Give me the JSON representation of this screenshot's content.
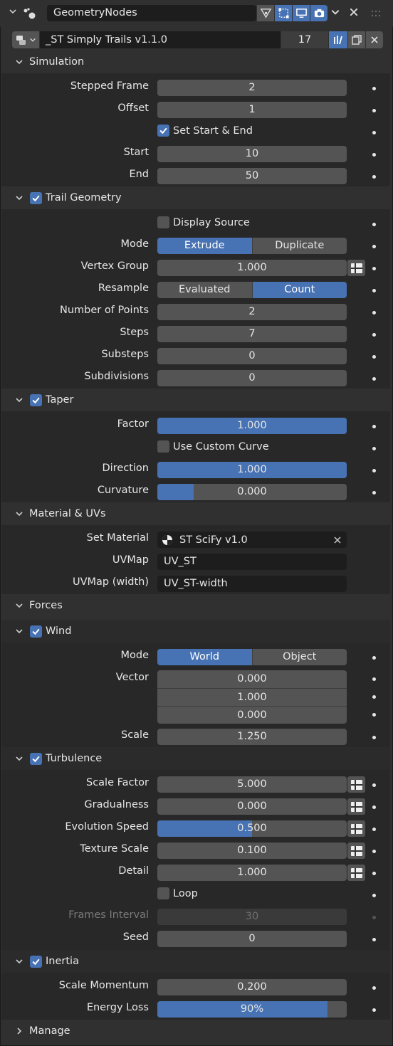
{
  "header": {
    "modifier_name": "GeometryNodes",
    "node_group": "_ST Simply Trails v1.1.0",
    "user_count": "17"
  },
  "sections": {
    "simulation": "Simulation",
    "trail_geometry": "Trail Geometry",
    "taper": "Taper",
    "material": "Material & UVs",
    "forces": "Forces",
    "wind": "Wind",
    "turbulence": "Turbulence",
    "inertia": "Inertia",
    "manage": "Manage"
  },
  "simulation": {
    "stepped_frame_label": "Stepped Frame",
    "stepped_frame": "2",
    "offset_label": "Offset",
    "offset": "1",
    "set_start_end": "Set Start & End",
    "start_label": "Start",
    "start": "10",
    "end_label": "End",
    "end": "50"
  },
  "trail": {
    "display_source": "Display Source",
    "mode_label": "Mode",
    "mode_a": "Extrude",
    "mode_b": "Duplicate",
    "vertex_group_label": "Vertex Group",
    "vertex_group": "1.000",
    "resample_label": "Resample",
    "resample_a": "Evaluated",
    "resample_b": "Count",
    "num_points_label": "Number of Points",
    "num_points": "2",
    "steps_label": "Steps",
    "steps": "7",
    "substeps_label": "Substeps",
    "substeps": "0",
    "subdivisions_label": "Subdivisions",
    "subdivisions": "0"
  },
  "taper": {
    "factor_label": "Factor",
    "factor": "1.000",
    "factor_fill": 1.0,
    "custom_curve": "Use Custom Curve",
    "direction_label": "Direction",
    "direction": "1.000",
    "direction_fill": 1.0,
    "curvature_label": "Curvature",
    "curvature": "0.000",
    "curvature_fill": 0.19
  },
  "material": {
    "set_material_label": "Set Material",
    "set_material": "ST SciFy v1.0",
    "uvmap_label": "UVMap",
    "uvmap": "UV_ST",
    "uvmap_width_label": "UVMap (width)",
    "uvmap_width": "UV_ST-width"
  },
  "wind": {
    "mode_label": "Mode",
    "mode_a": "World",
    "mode_b": "Object",
    "vector_label": "Vector",
    "vx": "0.000",
    "vy": "1.000",
    "vz": "0.000",
    "scale_label": "Scale",
    "scale": "1.250"
  },
  "turbulence": {
    "scale_factor_label": "Scale Factor",
    "scale_factor": "5.000",
    "gradualness_label": "Gradualness",
    "gradualness": "0.000",
    "evolution_label": "Evolution Speed",
    "evolution": "0.500",
    "evolution_fill": 0.5,
    "texture_scale_label": "Texture Scale",
    "texture_scale": "0.100",
    "detail_label": "Detail",
    "detail": "1.000",
    "loop": "Loop",
    "frames_interval_label": "Frames Interval",
    "frames_interval": "30",
    "seed_label": "Seed",
    "seed": "0"
  },
  "inertia": {
    "scale_momentum_label": "Scale Momentum",
    "scale_momentum": "0.200",
    "energy_loss_label": "Energy Loss",
    "energy_loss": "90%",
    "energy_loss_fill": 0.9
  },
  "colors": {
    "accent": "#4772b3",
    "field": "#545454",
    "panel": "#303030",
    "subpanel": "#282828"
  }
}
